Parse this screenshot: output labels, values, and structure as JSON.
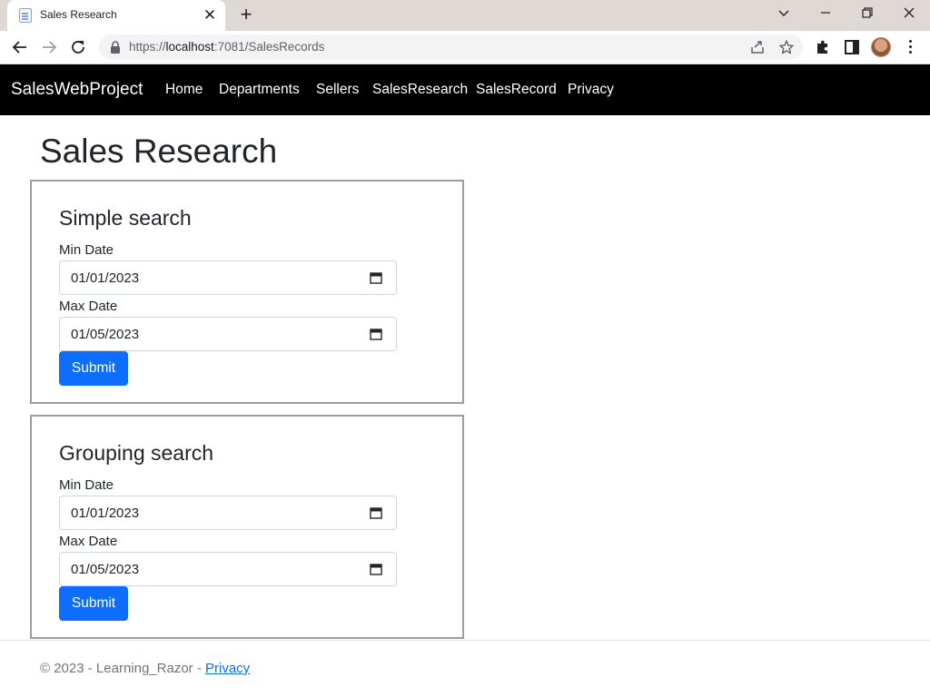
{
  "browser": {
    "tab_title": "Sales Research",
    "url_scheme": "https://",
    "url_host": "localhost",
    "url_rest": ":7081/SalesRecords"
  },
  "navbar": {
    "brand": "SalesWebProject",
    "links": [
      "Home",
      "Departments",
      "Sellers",
      "SalesResearch",
      "SalesRecord",
      "Privacy"
    ]
  },
  "page": {
    "title": "Sales Research"
  },
  "simple_search": {
    "title": "Simple search",
    "min_label": "Min Date",
    "min_value": "01/01/2023",
    "max_label": "Max Date",
    "max_value": "01/05/2023",
    "submit_label": "Submit"
  },
  "grouping_search": {
    "title": "Grouping search",
    "min_label": "Min Date",
    "min_value": "01/01/2023",
    "max_label": "Max Date",
    "max_value": "01/05/2023",
    "submit_label": "Submit"
  },
  "footer": {
    "text": "© 2023 - Learning_Razor - ",
    "link": "Privacy"
  },
  "colors": {
    "accent": "#0d6efd",
    "navbar_bg": "#000000"
  }
}
